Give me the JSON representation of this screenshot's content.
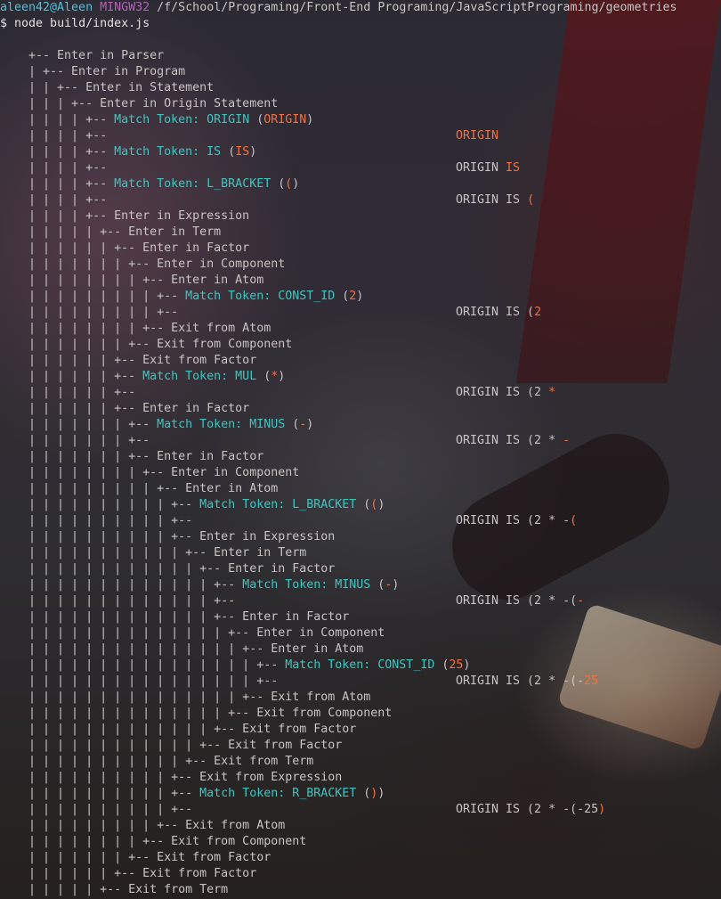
{
  "terminal": {
    "prompt": {
      "user_host": "aleen42@Aleen",
      "shell": "MINGW32",
      "path": "/f/School/Programing/Front-End Programing/JavaScriptPrograming/geometries",
      "dollar": "$",
      "command": "node build/index.js"
    },
    "lines": [
      {
        "text": "    +-- Enter in Parser"
      },
      {
        "text": "    | +-- Enter in Program"
      },
      {
        "text": "    | | +-- Enter in Statement"
      },
      {
        "text": "    | | | +-- Enter in Origin Statement"
      },
      {
        "tree": "    | | | | +-- ",
        "token": "Match Token: ORIGIN",
        "value": "ORIGIN"
      },
      {
        "text": "    | | | | +--",
        "out_base": "",
        "out_new": "ORIGIN"
      },
      {
        "tree": "    | | | | +-- ",
        "token": "Match Token: IS",
        "value": "IS"
      },
      {
        "text": "    | | | | +--",
        "out_base": "ORIGIN ",
        "out_new": "IS"
      },
      {
        "tree": "    | | | | +-- ",
        "token": "Match Token: L_BRACKET",
        "value": "("
      },
      {
        "text": "    | | | | +--",
        "out_base": "ORIGIN IS ",
        "out_new": "("
      },
      {
        "text": "    | | | | +-- Enter in Expression"
      },
      {
        "text": "    | | | | | +-- Enter in Term"
      },
      {
        "text": "    | | | | | | +-- Enter in Factor"
      },
      {
        "text": "    | | | | | | | +-- Enter in Component"
      },
      {
        "text": "    | | | | | | | | +-- Enter in Atom"
      },
      {
        "tree": "    | | | | | | | | | +-- ",
        "token": "Match Token: CONST_ID",
        "value": "2"
      },
      {
        "text": "    | | | | | | | | | +--",
        "out_base": "ORIGIN IS (",
        "out_new": "2"
      },
      {
        "text": "    | | | | | | | | +-- Exit from Atom"
      },
      {
        "text": "    | | | | | | | +-- Exit from Component"
      },
      {
        "text": "    | | | | | | +-- Exit from Factor"
      },
      {
        "tree": "    | | | | | | +-- ",
        "token": "Match Token: MUL",
        "value": "*"
      },
      {
        "text": "    | | | | | | +--",
        "out_base": "ORIGIN IS (2 ",
        "out_new": "*"
      },
      {
        "text": "    | | | | | | +-- Enter in Factor"
      },
      {
        "tree": "    | | | | | | | +-- ",
        "token": "Match Token: MINUS",
        "value": "-"
      },
      {
        "text": "    | | | | | | | +--",
        "out_base": "ORIGIN IS (2 * ",
        "out_new": "-"
      },
      {
        "text": "    | | | | | | | +-- Enter in Factor"
      },
      {
        "text": "    | | | | | | | | +-- Enter in Component"
      },
      {
        "text": "    | | | | | | | | | +-- Enter in Atom"
      },
      {
        "tree": "    | | | | | | | | | | +-- ",
        "token": "Match Token: L_BRACKET",
        "value": "("
      },
      {
        "text": "    | | | | | | | | | | +--",
        "out_base": "ORIGIN IS (2 * -",
        "out_new": "("
      },
      {
        "text": "    | | | | | | | | | | +-- Enter in Expression"
      },
      {
        "text": "    | | | | | | | | | | | +-- Enter in Term"
      },
      {
        "text": "    | | | | | | | | | | | | +-- Enter in Factor"
      },
      {
        "tree": "    | | | | | | | | | | | | | +-- ",
        "token": "Match Token: MINUS",
        "value": "-"
      },
      {
        "text": "    | | | | | | | | | | | | | +--",
        "out_base": "ORIGIN IS (2 * -(",
        "out_new": "-"
      },
      {
        "text": "    | | | | | | | | | | | | | +-- Enter in Factor"
      },
      {
        "text": "    | | | | | | | | | | | | | | +-- Enter in Component"
      },
      {
        "text": "    | | | | | | | | | | | | | | | +-- Enter in Atom"
      },
      {
        "tree": "    | | | | | | | | | | | | | | | | +-- ",
        "token": "Match Token: CONST_ID",
        "value": "25"
      },
      {
        "text": "    | | | | | | | | | | | | | | | | +--",
        "out_base": "ORIGIN IS (2 * -(-",
        "out_new": "25"
      },
      {
        "text": "    | | | | | | | | | | | | | | | +-- Exit from Atom"
      },
      {
        "text": "    | | | | | | | | | | | | | | +-- Exit from Component"
      },
      {
        "text": "    | | | | | | | | | | | | | +-- Exit from Factor"
      },
      {
        "text": "    | | | | | | | | | | | | +-- Exit from Factor"
      },
      {
        "text": "    | | | | | | | | | | | +-- Exit from Term"
      },
      {
        "text": "    | | | | | | | | | | +-- Exit from Expression"
      },
      {
        "tree": "    | | | | | | | | | | +-- ",
        "token": "Match Token: R_BRACKET",
        "value": ")"
      },
      {
        "text": "    | | | | | | | | | | +--",
        "out_base": "ORIGIN IS (2 * -(-25",
        "out_new": ")"
      },
      {
        "text": "    | | | | | | | | | +-- Exit from Atom"
      },
      {
        "text": "    | | | | | | | | +-- Exit from Component"
      },
      {
        "text": "    | | | | | | | +-- Exit from Factor"
      },
      {
        "text": "    | | | | | | +-- Exit from Factor"
      },
      {
        "text": "    | | | | | +-- Exit from Term"
      }
    ]
  },
  "colors": {
    "token": "#3ec5c0",
    "value_highlight": "#f07142",
    "text": "#c9c3c3",
    "prompt_user": "#4fc0d8",
    "prompt_shell": "#b65fb8"
  }
}
